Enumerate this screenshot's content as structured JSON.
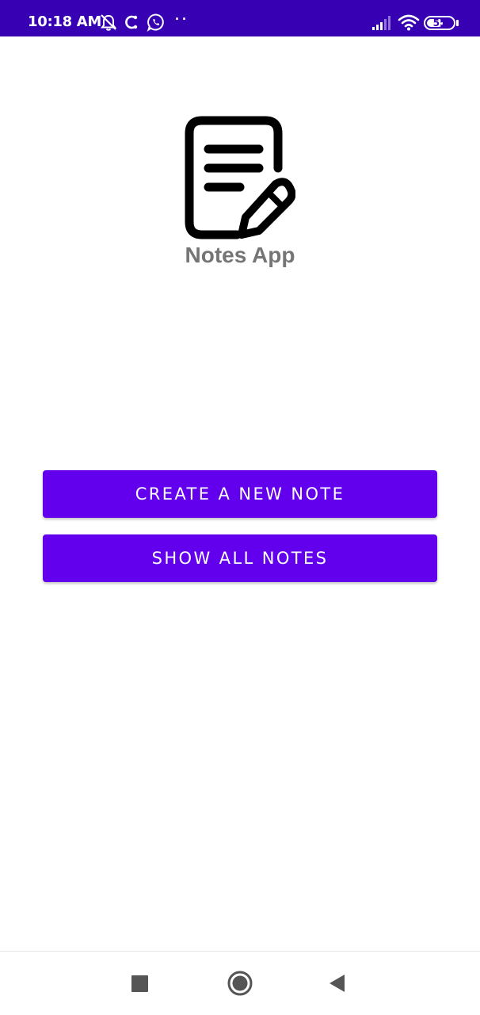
{
  "status_bar": {
    "time": "10:18 AM",
    "battery_level": "55",
    "battery_fraction": 0.55,
    "background_color": "#3700b3",
    "left_icons": [
      "alarm-off-icon",
      "sync-icon",
      "whatsapp-icon",
      "more-dots-icon"
    ],
    "right_icons": [
      "signal-icon",
      "wifi-icon",
      "battery-icon"
    ]
  },
  "app": {
    "logo_icon": "note-edit-icon",
    "title": "Notes App",
    "title_color": "#757575"
  },
  "actions": {
    "create_label": "CREATE A NEW NOTE",
    "show_label": "SHOW ALL NOTES",
    "button_color": "#6200ee"
  },
  "nav_bar": {
    "icons": [
      "recents-square-icon",
      "home-circle-icon",
      "back-triangle-icon"
    ]
  }
}
